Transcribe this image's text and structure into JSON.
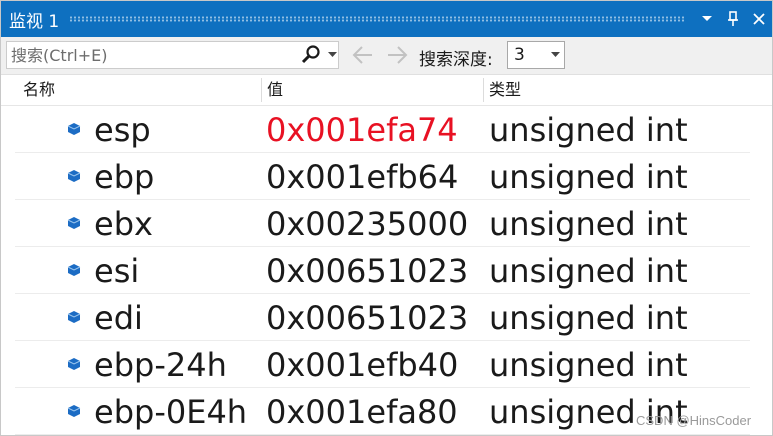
{
  "window": {
    "title": "监视 1",
    "title_bg": "#0e70c0",
    "buttons": [
      {
        "name": "dropdown-icon",
        "glyph": "▼"
      },
      {
        "name": "pin-icon",
        "glyph": "📌"
      },
      {
        "name": "close-icon",
        "glyph": "✕"
      }
    ]
  },
  "toolbar": {
    "search_placeholder": "搜索(Ctrl+E)",
    "search_icon": "search-icon",
    "back_icon": "arrow-left-icon",
    "forward_icon": "arrow-right-icon",
    "depth_label": "搜索深度:",
    "depth_value": "3"
  },
  "columns": {
    "name": "名称",
    "value": "值",
    "type": "类型"
  },
  "rows": [
    {
      "name": "esp",
      "value": "0x001efa74",
      "type": "unsigned int",
      "changed": true
    },
    {
      "name": "ebp",
      "value": "0x001efb64",
      "type": "unsigned int",
      "changed": false
    },
    {
      "name": "ebx",
      "value": "0x00235000",
      "type": "unsigned int",
      "changed": false
    },
    {
      "name": "esi",
      "value": "0x00651023",
      "type": "unsigned int",
      "changed": false
    },
    {
      "name": "edi",
      "value": "0x00651023",
      "type": "unsigned int",
      "changed": false
    },
    {
      "name": "ebp-24h",
      "value": "0x001efb40",
      "type": "unsigned int",
      "changed": false
    },
    {
      "name": "ebp-0E4h",
      "value": "0x001efa80",
      "type": "unsigned int",
      "changed": false
    }
  ],
  "colors": {
    "changed_value": "#e81123",
    "normal_text": "#1a1a1a",
    "variable_icon": "#1c6cc4"
  },
  "watermark": "CSDN @HinsCoder"
}
